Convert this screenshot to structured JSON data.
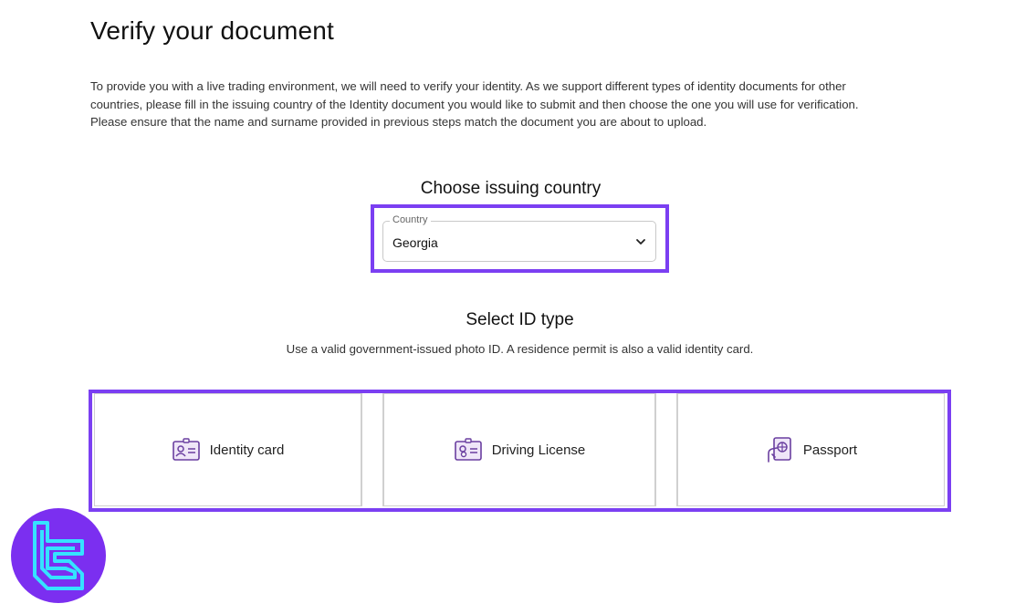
{
  "page": {
    "title": "Verify your document",
    "intro": [
      "To provide you with a live trading environment, we will need to verify your identity. As we support different types of identity documents for other",
      "countries, please fill in the issuing country of the Identity document you would like to submit and then choose the one you will use for verification.",
      "Please ensure that the name and surname provided in previous steps match the document you are about to upload."
    ]
  },
  "country_section": {
    "title": "Choose issuing country",
    "field_label": "Country",
    "selected_value": "Georgia"
  },
  "id_section": {
    "title": "Select ID type",
    "subtitle": "Use a valid government-issued photo ID. A residence permit is also a valid identity card.",
    "options": [
      {
        "label": "Identity card",
        "icon": "id-card-icon"
      },
      {
        "label": "Driving License",
        "icon": "driving-license-icon"
      },
      {
        "label": "Passport",
        "icon": "passport-icon"
      }
    ]
  },
  "colors": {
    "accent": "#7b3ff2",
    "icon": "#6a3fa0",
    "logo_bg": "#7b2ff0",
    "logo_mark": "#35e3ff"
  }
}
